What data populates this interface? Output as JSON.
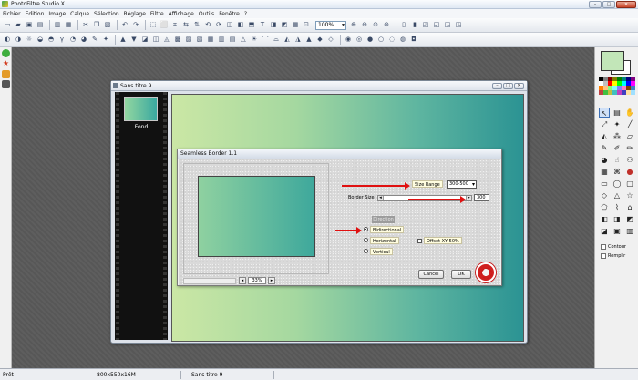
{
  "app": {
    "title": "PhotoFiltre Studio X"
  },
  "window_controls": {
    "minimize": "–",
    "maximize": "□",
    "close": "✕"
  },
  "menu": [
    {
      "label": "Fichier"
    },
    {
      "label": "Edition"
    },
    {
      "label": "Image"
    },
    {
      "label": "Calque"
    },
    {
      "label": "Sélection"
    },
    {
      "label": "Réglage"
    },
    {
      "label": "Filtre"
    },
    {
      "label": "Affichage"
    },
    {
      "label": "Outils"
    },
    {
      "label": "Fenêtre"
    },
    {
      "label": "?"
    }
  ],
  "toolbar": {
    "zoom": "100%"
  },
  "document": {
    "title": "Sans titre 9",
    "layer_label": "Fond"
  },
  "dialog": {
    "title": "Seamless Border 1.1",
    "size_range_label": "Size Range",
    "size_range_value": "300-500",
    "border_size_label": "Border Size",
    "border_size_value": "300",
    "direction_caption": "Direction",
    "options": {
      "bidirectional": "Bidirectional",
      "horizontal": "Horizontal",
      "vertical": "Vertical"
    },
    "offset_label": "Offset XY 50%",
    "zoom_value": "33%",
    "zoom_minus": "◂",
    "zoom_plus": "▸",
    "cancel": "Cancel",
    "ok": "OK",
    "colors": {
      "arrow": "#e01010"
    }
  },
  "tools_panel": {
    "contour": "Contour",
    "fill": "Remplir"
  },
  "status": {
    "ready": "Prêt",
    "size": "800x550x16M",
    "name": "Sans titre 9"
  }
}
